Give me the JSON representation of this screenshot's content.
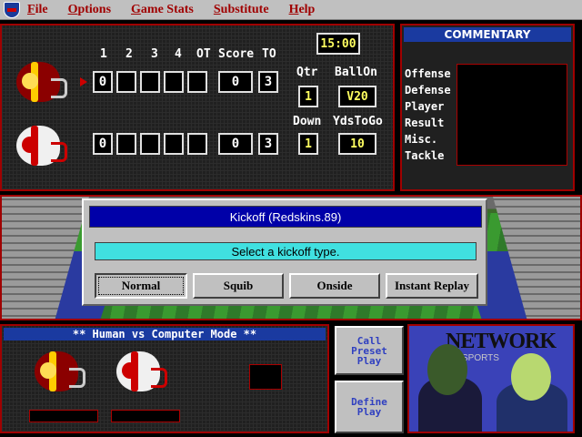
{
  "menu": [
    {
      "pre": "",
      "key": "F",
      "rest": "ile"
    },
    {
      "pre": "",
      "key": "O",
      "rest": "ptions"
    },
    {
      "pre": "",
      "key": "G",
      "rest": "ame Stats"
    },
    {
      "pre": "",
      "key": "S",
      "rest": "ubstitute"
    },
    {
      "pre": "",
      "key": "H",
      "rest": "elp"
    }
  ],
  "scoreboard": {
    "headers": [
      "1",
      "2",
      "3",
      "4",
      "OT",
      "Score",
      "TO"
    ],
    "clock": "15:00",
    "home": {
      "q1": "0",
      "q2": "",
      "q3": "",
      "q4": "",
      "ot": "",
      "score": "0",
      "to": "3"
    },
    "away": {
      "q1": "0",
      "q2": "",
      "q3": "",
      "q4": "",
      "ot": "",
      "score": "0",
      "to": "3"
    },
    "qtr_label": "Qtr",
    "qtr": "1",
    "ballon_label": "BallOn",
    "ballon": "V20",
    "down_label": "Down",
    "down": "1",
    "ydstogo_label": "YdsToGo",
    "ydstogo": "10"
  },
  "commentary": {
    "title": "COMMENTARY",
    "labels": [
      "Offense",
      "Defense",
      "Player",
      "Result",
      "Misc.",
      "Tackle"
    ]
  },
  "dialog": {
    "title": "Kickoff (Redskins.89)",
    "message": "Select a kickoff type.",
    "buttons": [
      "Normal",
      "Squib",
      "Onside",
      "Instant Replay"
    ]
  },
  "mode": {
    "title": "** Human vs Computer Mode **"
  },
  "actions": {
    "call_preset": "Call\nPreset\nPlay",
    "define": "Define\nPlay"
  },
  "network": {
    "logo": "NETWORK",
    "sub": "SPORTS"
  },
  "colors": {
    "accent": "#a00000",
    "title_bar": "#0000a8",
    "message_bg": "#40e0e0",
    "team_home": "#8b0000"
  }
}
